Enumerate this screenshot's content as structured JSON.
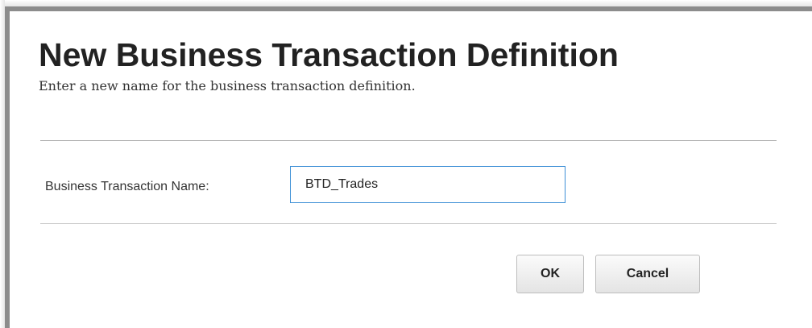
{
  "dialog": {
    "title": "New Business Transaction Definition",
    "subtitle": "Enter a new name for the business transaction definition.",
    "field": {
      "label": "Business Transaction Name:",
      "value": "BTD_Trades"
    },
    "buttons": {
      "ok_label": "OK",
      "cancel_label": "Cancel"
    }
  },
  "colors": {
    "frame": "#8c8c8c",
    "input_focus_border": "#3c8fd6",
    "title_text": "#222222"
  }
}
